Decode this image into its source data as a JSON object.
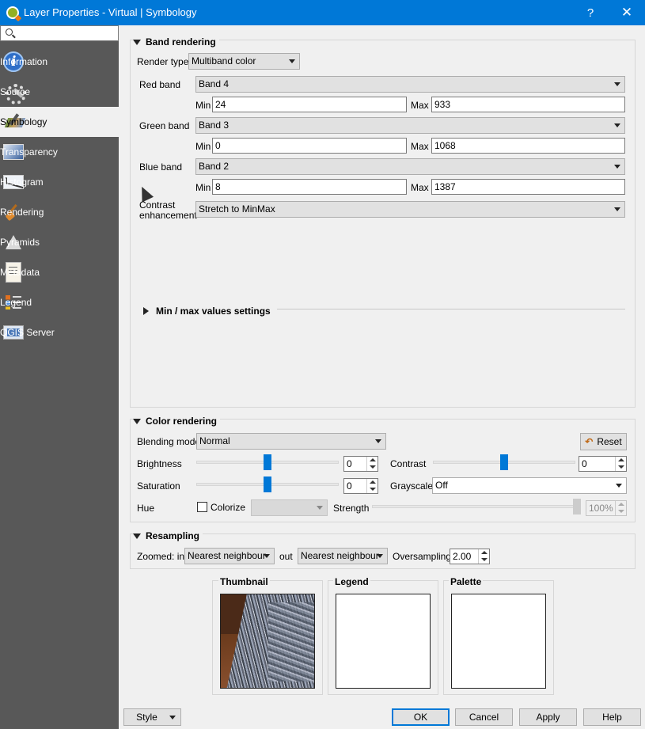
{
  "window": {
    "title": "Layer Properties - Virtual | Symbology",
    "help": "?",
    "close": "✕"
  },
  "sidebar": {
    "search_placeholder": "",
    "items": [
      {
        "label": "Information",
        "icon": "info-icon"
      },
      {
        "label": "Source",
        "icon": "source-icon"
      },
      {
        "label": "Symbology",
        "icon": "symbology-icon",
        "active": true
      },
      {
        "label": "Transparency",
        "icon": "transparency-icon"
      },
      {
        "label": "Histogram",
        "icon": "histogram-icon"
      },
      {
        "label": "Rendering",
        "icon": "rendering-icon"
      },
      {
        "label": "Pyramids",
        "icon": "pyramids-icon"
      },
      {
        "label": "Metadata",
        "icon": "metadata-icon"
      },
      {
        "label": "Legend",
        "icon": "legend-icon"
      },
      {
        "label": "QGIS Server",
        "icon": "qgis-server-icon"
      }
    ]
  },
  "band_rendering": {
    "title": "Band rendering",
    "render_type_label": "Render type",
    "render_type": "Multiband color",
    "red_label": "Red band",
    "red_band": "Band 4",
    "green_label": "Green band",
    "green_band": "Band 3",
    "blue_label": "Blue band",
    "blue_band": "Band 2",
    "min_label": "Min",
    "max_label": "Max",
    "red_min": "24",
    "red_max": "933",
    "green_min": "0",
    "green_max": "1068",
    "blue_min": "8",
    "blue_max": "1387",
    "contrast_label_1": "Contrast",
    "contrast_label_2": "enhancement",
    "contrast_enhancement": "Stretch to MinMax",
    "minmax_settings": "Min / max values settings"
  },
  "color_rendering": {
    "title": "Color rendering",
    "blending_label": "Blending mode",
    "blending_mode": "Normal",
    "reset_label": "Reset",
    "brightness_label": "Brightness",
    "brightness": "0",
    "contrast_label": "Contrast",
    "contrast": "0",
    "saturation_label": "Saturation",
    "saturation": "0",
    "grayscale_label": "Grayscale",
    "grayscale": "Off",
    "hue_label": "Hue",
    "colorize_label": "Colorize",
    "strength_label": "Strength",
    "strength": "100%",
    "brightness_level": 0.5,
    "contrast_level": 0.5,
    "saturation_level": 0.5,
    "strength_level": 1.0
  },
  "resampling": {
    "title": "Resampling",
    "zoomed_in_label": "Zoomed: in",
    "zoomed_in": "Nearest neighbour",
    "out_label": "out",
    "zoomed_out": "Nearest neighbour",
    "oversampling_label": "Oversampling",
    "oversampling": "2.00"
  },
  "previews": {
    "thumbnail": "Thumbnail",
    "legend": "Legend",
    "palette": "Palette"
  },
  "buttons": {
    "style": "Style",
    "ok": "OK",
    "cancel": "Cancel",
    "apply": "Apply",
    "help": "Help"
  },
  "colors": {
    "title_bar": "#0078d7",
    "sidebar": "#585858",
    "accent": "#0078d7"
  }
}
